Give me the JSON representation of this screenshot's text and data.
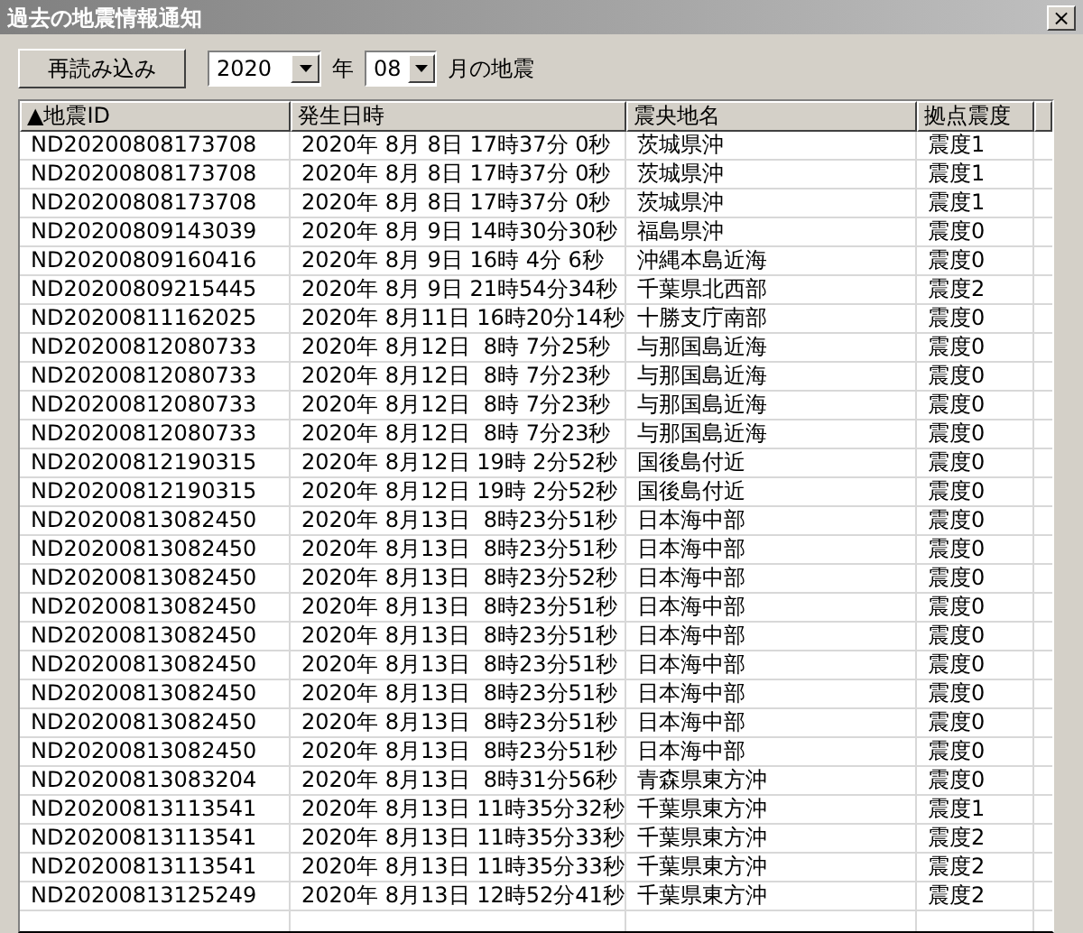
{
  "window": {
    "title": "過去の地震情報通知",
    "close": "×"
  },
  "toolbar": {
    "reload_button": "再読み込み",
    "year": {
      "value": "2020"
    },
    "year_label": "年",
    "month": {
      "value": "08"
    },
    "month_label": "月の地震"
  },
  "table": {
    "columns": [
      {
        "label": "▲地震ID"
      },
      {
        "label": "発生日時"
      },
      {
        "label": "震央地名"
      },
      {
        "label": "拠点震度"
      }
    ],
    "rows": [
      [
        "ND20200808173708",
        "2020年 8月 8日 17時37分 0秒",
        "茨城県沖",
        "震度1"
      ],
      [
        "ND20200808173708",
        "2020年 8月 8日 17時37分 0秒",
        "茨城県沖",
        "震度1"
      ],
      [
        "ND20200808173708",
        "2020年 8月 8日 17時37分 0秒",
        "茨城県沖",
        "震度1"
      ],
      [
        "ND20200809143039",
        "2020年 8月 9日 14時30分30秒",
        "福島県沖",
        "震度0"
      ],
      [
        "ND20200809160416",
        "2020年 8月 9日 16時 4分 6秒",
        "沖縄本島近海",
        "震度0"
      ],
      [
        "ND20200809215445",
        "2020年 8月 9日 21時54分34秒",
        "千葉県北西部",
        "震度2"
      ],
      [
        "ND20200811162025",
        "2020年 8月11日 16時20分14秒",
        "十勝支庁南部",
        "震度0"
      ],
      [
        "ND20200812080733",
        "2020年 8月12日  8時 7分25秒",
        "与那国島近海",
        "震度0"
      ],
      [
        "ND20200812080733",
        "2020年 8月12日  8時 7分23秒",
        "与那国島近海",
        "震度0"
      ],
      [
        "ND20200812080733",
        "2020年 8月12日  8時 7分23秒",
        "与那国島近海",
        "震度0"
      ],
      [
        "ND20200812080733",
        "2020年 8月12日  8時 7分23秒",
        "与那国島近海",
        "震度0"
      ],
      [
        "ND20200812190315",
        "2020年 8月12日 19時 2分52秒",
        "国後島付近",
        "震度0"
      ],
      [
        "ND20200812190315",
        "2020年 8月12日 19時 2分52秒",
        "国後島付近",
        "震度0"
      ],
      [
        "ND20200813082450",
        "2020年 8月13日  8時23分51秒",
        "日本海中部",
        "震度0"
      ],
      [
        "ND20200813082450",
        "2020年 8月13日  8時23分51秒",
        "日本海中部",
        "震度0"
      ],
      [
        "ND20200813082450",
        "2020年 8月13日  8時23分52秒",
        "日本海中部",
        "震度0"
      ],
      [
        "ND20200813082450",
        "2020年 8月13日  8時23分51秒",
        "日本海中部",
        "震度0"
      ],
      [
        "ND20200813082450",
        "2020年 8月13日  8時23分51秒",
        "日本海中部",
        "震度0"
      ],
      [
        "ND20200813082450",
        "2020年 8月13日  8時23分51秒",
        "日本海中部",
        "震度0"
      ],
      [
        "ND20200813082450",
        "2020年 8月13日  8時23分51秒",
        "日本海中部",
        "震度0"
      ],
      [
        "ND20200813082450",
        "2020年 8月13日  8時23分51秒",
        "日本海中部",
        "震度0"
      ],
      [
        "ND20200813082450",
        "2020年 8月13日  8時23分51秒",
        "日本海中部",
        "震度0"
      ],
      [
        "ND20200813083204",
        "2020年 8月13日  8時31分56秒",
        "青森県東方沖",
        "震度0"
      ],
      [
        "ND20200813113541",
        "2020年 8月13日 11時35分32秒",
        "千葉県東方沖",
        "震度1"
      ],
      [
        "ND20200813113541",
        "2020年 8月13日 11時35分33秒",
        "千葉県東方沖",
        "震度2"
      ],
      [
        "ND20200813113541",
        "2020年 8月13日 11時35分33秒",
        "千葉県東方沖",
        "震度2"
      ],
      [
        "ND20200813125249",
        "2020年 8月13日 12時52分41秒",
        "千葉県東方沖",
        "震度2"
      ]
    ]
  }
}
